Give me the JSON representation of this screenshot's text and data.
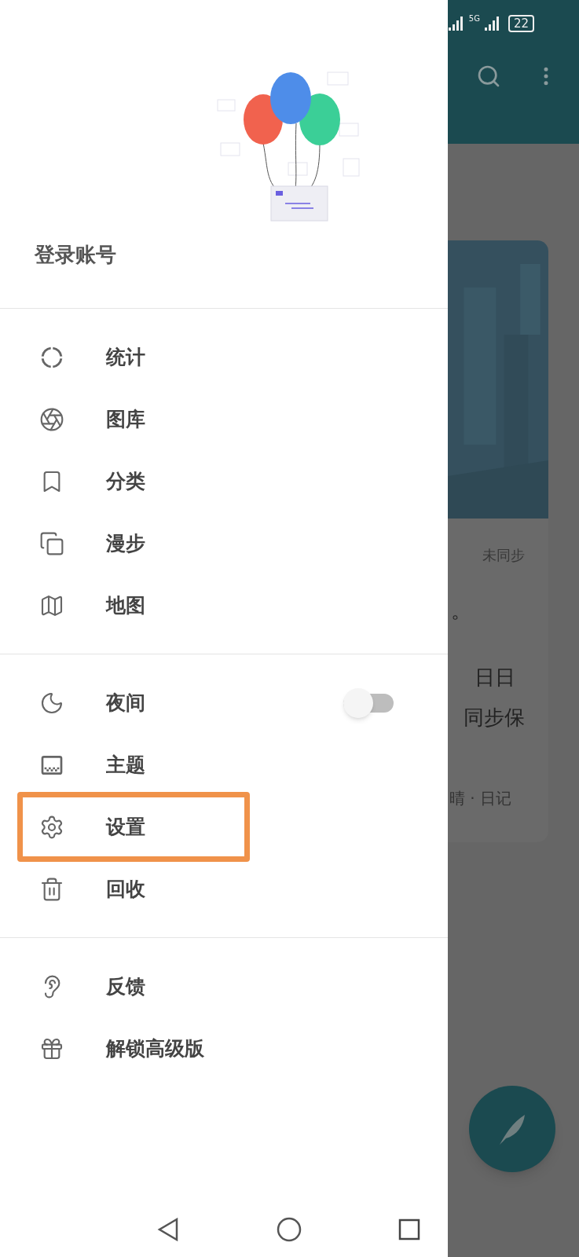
{
  "drawer": {
    "account_label": "登录账号",
    "sections": [
      {
        "items": [
          {
            "label": "统计",
            "kind": "link"
          },
          {
            "label": "图库",
            "kind": "link"
          },
          {
            "label": "分类",
            "kind": "link"
          },
          {
            "label": "漫步",
            "kind": "link"
          },
          {
            "label": "地图",
            "kind": "link"
          }
        ]
      },
      {
        "items": [
          {
            "label": "夜间",
            "kind": "toggle",
            "on": false,
            "highlighted": false
          },
          {
            "label": "主题",
            "kind": "link",
            "highlighted": false
          },
          {
            "label": "设置",
            "kind": "link",
            "highlighted": true
          },
          {
            "label": "回收",
            "kind": "link",
            "highlighted": false
          }
        ]
      },
      {
        "items": [
          {
            "label": "反馈",
            "kind": "link"
          },
          {
            "label": "解锁高级版",
            "kind": "link"
          }
        ]
      }
    ]
  },
  "status_bar": {
    "network": "5G",
    "battery": "22"
  },
  "card": {
    "sync_status": "未同步",
    "lines": [
      "。",
      "日日",
      "同步保"
    ],
    "footer": "晴 · 日记"
  }
}
